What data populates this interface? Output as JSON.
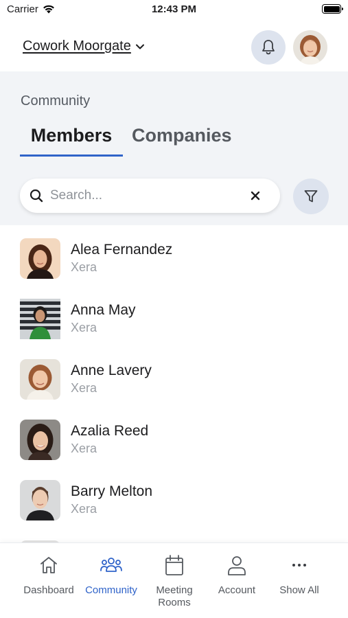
{
  "status_bar": {
    "carrier": "Carrier",
    "time": "12:43 PM"
  },
  "header": {
    "location": "Cowork Moorgate"
  },
  "community": {
    "title": "Community",
    "tabs": [
      {
        "label": "Members",
        "active": true
      },
      {
        "label": "Companies",
        "active": false
      }
    ],
    "search": {
      "placeholder": "Search...",
      "value": ""
    }
  },
  "members": [
    {
      "name": "Alea Fernandez",
      "company": "Xera"
    },
    {
      "name": "Anna May",
      "company": "Xera"
    },
    {
      "name": "Anne Lavery",
      "company": "Xera"
    },
    {
      "name": "Azalia Reed",
      "company": "Xera"
    },
    {
      "name": "Barry Melton",
      "company": "Xera"
    }
  ],
  "tab_bar": {
    "items": [
      {
        "label": "Dashboard",
        "icon": "home-icon",
        "active": false
      },
      {
        "label": "Community",
        "icon": "people-icon",
        "active": true
      },
      {
        "label": "Meeting\nRooms",
        "icon": "calendar-icon",
        "active": false
      },
      {
        "label": "Account",
        "icon": "person-icon",
        "active": false
      },
      {
        "label": "Show All",
        "icon": "more-icon",
        "active": false
      }
    ]
  },
  "colors": {
    "accent": "#2f63c9",
    "panel": "#f2f4f7",
    "icon_button_bg": "#dde3ee"
  }
}
